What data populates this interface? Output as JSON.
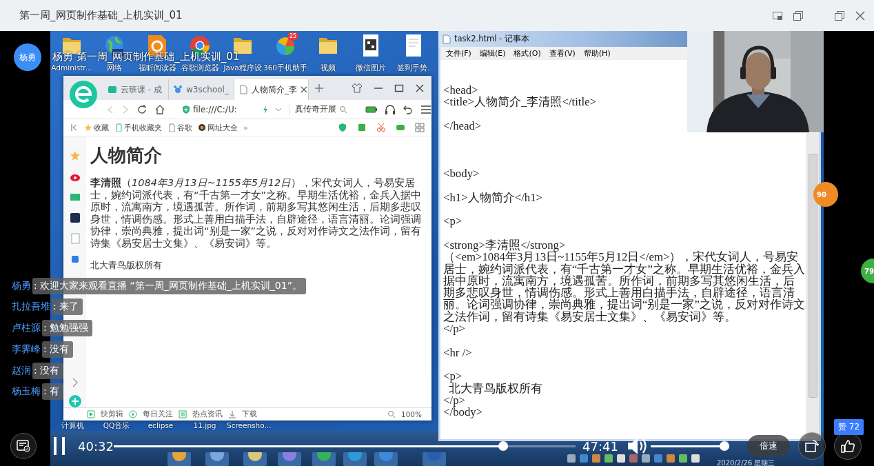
{
  "window": {
    "title": "第一周_网页制作基础_上机实训_01"
  },
  "stream": {
    "host": "杨勇",
    "title": "杨勇 第一周_网页制作基础_上机实训_01"
  },
  "desktop": {
    "icons": [
      {
        "kind": "folder",
        "label": "Administr..."
      },
      {
        "kind": "globe",
        "label": "网络"
      },
      {
        "kind": "reader",
        "label": "福昕阅读器"
      },
      {
        "kind": "chrome",
        "label": "谷歌浏览器"
      },
      {
        "kind": "folder",
        "label": "Java程序设"
      },
      {
        "kind": "app360",
        "label": "360手机助手",
        "badge": "25"
      },
      {
        "kind": "folder",
        "label": "视频"
      },
      {
        "kind": "qr",
        "label": "微信图片"
      },
      {
        "kind": "doc",
        "label": "签到手势."
      }
    ],
    "bottom_labels": [
      "计算机",
      "QQ音乐",
      "eclipse",
      "11.jpg",
      "Screensho..."
    ],
    "date": "2020/2/26 星期三"
  },
  "browser": {
    "tabs": [
      {
        "label": "云班课 - 成",
        "selected": false
      },
      {
        "label": "w3school_",
        "selected": false
      },
      {
        "label": "人物简介_李",
        "selected": true
      }
    ],
    "address": "file:///C:/U:",
    "search": "真传奇开展",
    "bookmarks": [
      "收藏",
      "手机收藏夹",
      "谷歌",
      "网址大全"
    ],
    "more": "»",
    "page": {
      "heading": "人物简介",
      "paragraph": "**李清照**（*1084年3月13日~1155年5月12日*），宋代女词人，号易安居士，婉约词派代表，有“千古第一才女”之称。早期生活优裕，金兵入据中原时，流寓南方，境遇孤苦。所作词，前期多写其悠闲生活，后期多悲叹身世，情调伤感。形式上善用白描手法，自辟途径，语言清丽。论词强调协律，崇尚典雅，提出词“别是一家”之说，反对对作诗文之法作词，留有诗集《易安居士文集》、《易安词》等。",
      "footer": "北大青鸟版权所有"
    },
    "status_items": [
      "快剪辑",
      "每日关注",
      "热点资讯",
      "下载"
    ],
    "zoom": "100%"
  },
  "notepad": {
    "title": "task2.html - 记事本",
    "menu": [
      "文件(F)",
      "编辑(E)",
      "格式(O)",
      "查看(V)",
      "帮助(H)"
    ],
    "code": [
      "<head>\n<title>人物简介_李清照</title>\n\n</head>",
      "<body>\n\n<h1>人物简介</h1>\n\n<p>\n\n<strong>李清照</strong>\n（<em>1084年3月13日~1155年5月12日</em>），宋代女词人，号易安居士，婉约词派代表，有“千古第一才女”之称。早期生活优裕，金兵入据中原时，流寓南方，境遇孤苦。所作词，前期多写其悠闲生活，后期多悲叹身世，情调伤感。形式上善用白描手法，自辟途径，语言清丽。论词强调协律，崇尚典雅，提出词“别是一家”之说，反对对作诗文之法作词，留有诗集《易安居士文集》、《易安词》等。\n</p>\n\n<hr />\n\n<p>\n  北大青鸟版权所有\n</p>\n</body>"
    ]
  },
  "side_badges": [
    {
      "text": "90",
      "color": "#f08a24"
    },
    {
      "text": "79",
      "color": "#3cb043"
    }
  ],
  "chat": [
    {
      "name": "杨勇",
      "text": ": 欢迎大家来观看直播 “第一周_网页制作基础_上机实训_01”。"
    },
    {
      "name": "扎拉吾堆",
      "text": ": 来了"
    },
    {
      "name": "卢柱源",
      "text": ": 勉勉强强"
    },
    {
      "name": "李霁峰",
      "text": ": 没有"
    },
    {
      "name": "赵润",
      "text": ": 没有"
    },
    {
      "name": "杨玉梅",
      "text": ": 有"
    }
  ],
  "player": {
    "playing": true,
    "elapsed": "40:32",
    "progress": {
      "level": 0.85
    },
    "duration": "47:41",
    "volume": {
      "level": 1
    },
    "speed_button": "倍速",
    "likes": "赞 72"
  }
}
